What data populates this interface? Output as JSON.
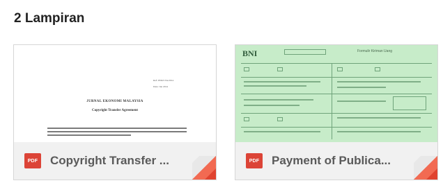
{
  "attachments_heading": "2 Lampiran",
  "attachments": [
    {
      "file_label": "Copyright Transfer ...",
      "type_badge": "PDF",
      "preview": {
        "meta_line_1": "Ref: JEM/CTA/2014",
        "meta_line_2": "Date: Jan 2014",
        "title_line_1": "JURNAL EKONOMI MALAYSIA",
        "title_line_2": "Copyright Transfer Agreement"
      }
    },
    {
      "file_label": "Payment of Publica...",
      "type_badge": "PDF",
      "preview": {
        "logo_text": "BNI",
        "form_title": "Formulir Kiriman Uang"
      }
    }
  ],
  "colors": {
    "pdf_red": "#dc4437",
    "footer_bg": "#f1f1f1",
    "form_green": "#c7ecc9"
  }
}
